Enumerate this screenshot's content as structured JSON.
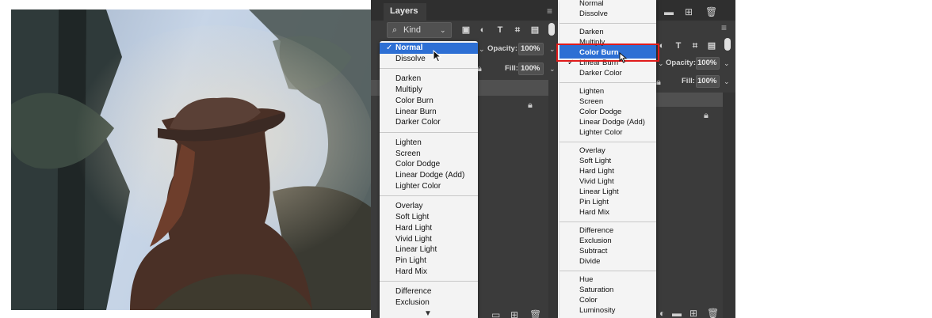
{
  "left_panel": {
    "title": "Layers",
    "kind_label": "Kind",
    "opacity_label": "Opacity:",
    "opacity_value": "100%",
    "fill_label": "Fill:",
    "fill_value": "100%",
    "blend_options": [
      {
        "label": "Normal",
        "checked": true,
        "selected": true
      },
      {
        "label": "Dissolve"
      },
      {
        "label": "Darken"
      },
      {
        "label": "Multiply"
      },
      {
        "label": "Color Burn"
      },
      {
        "label": "Linear Burn"
      },
      {
        "label": "Darker Color"
      },
      {
        "label": "Lighten"
      },
      {
        "label": "Screen"
      },
      {
        "label": "Color Dodge"
      },
      {
        "label": "Linear Dodge (Add)"
      },
      {
        "label": "Lighter Color"
      },
      {
        "label": "Overlay"
      },
      {
        "label": "Soft Light"
      },
      {
        "label": "Hard Light"
      },
      {
        "label": "Vivid Light"
      },
      {
        "label": "Linear Light"
      },
      {
        "label": "Pin Light"
      },
      {
        "label": "Hard Mix"
      },
      {
        "label": "Difference"
      },
      {
        "label": "Exclusion"
      }
    ],
    "check_glyph": "✓",
    "more_arrow": "▼"
  },
  "right_panel": {
    "opacity_label": "Opacity:",
    "opacity_value": "100%",
    "fill_label": "Fill:",
    "fill_value": "100%",
    "blend_options": [
      {
        "label": "Normal"
      },
      {
        "label": "Dissolve"
      },
      {
        "label": "Darken"
      },
      {
        "label": "Multiply"
      },
      {
        "label": "Color Burn",
        "selected": true
      },
      {
        "label": "Linear Burn",
        "checked": true
      },
      {
        "label": "Darker Color"
      },
      {
        "label": "Lighten"
      },
      {
        "label": "Screen"
      },
      {
        "label": "Color Dodge"
      },
      {
        "label": "Linear Dodge (Add)"
      },
      {
        "label": "Lighter Color"
      },
      {
        "label": "Overlay"
      },
      {
        "label": "Soft Light"
      },
      {
        "label": "Hard Light"
      },
      {
        "label": "Vivid Light"
      },
      {
        "label": "Linear Light"
      },
      {
        "label": "Pin Light"
      },
      {
        "label": "Hard Mix"
      },
      {
        "label": "Difference"
      },
      {
        "label": "Exclusion"
      },
      {
        "label": "Subtract"
      },
      {
        "label": "Divide"
      },
      {
        "label": "Hue"
      },
      {
        "label": "Saturation"
      },
      {
        "label": "Color"
      },
      {
        "label": "Luminosity"
      }
    ],
    "check_glyph": "✓"
  },
  "colors": {
    "panel_bg": "#3b3b3b",
    "menu_bg": "#f3f3f3",
    "selection": "#2d6fd4",
    "annotation_red": "#e01b1b"
  }
}
